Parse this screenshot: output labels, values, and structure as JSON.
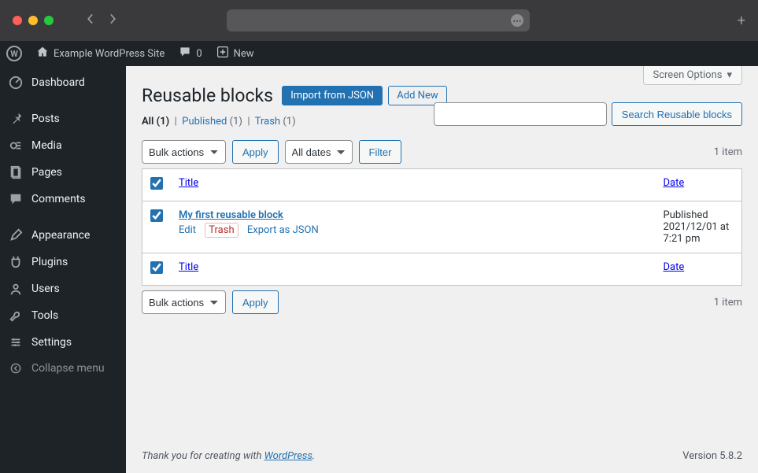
{
  "browser": {
    "plus": "+"
  },
  "adminbar": {
    "site_name": "Example WordPress Site",
    "comments_count": "0",
    "new_label": "New"
  },
  "sidebar": {
    "items": [
      {
        "icon": "dashboard",
        "label": "Dashboard"
      },
      {
        "icon": "pin",
        "label": "Posts"
      },
      {
        "icon": "media",
        "label": "Media"
      },
      {
        "icon": "page",
        "label": "Pages"
      },
      {
        "icon": "comment",
        "label": "Comments"
      },
      {
        "icon": "appearance",
        "label": "Appearance"
      },
      {
        "icon": "plugin",
        "label": "Plugins"
      },
      {
        "icon": "user",
        "label": "Users"
      },
      {
        "icon": "tool",
        "label": "Tools"
      },
      {
        "icon": "settings",
        "label": "Settings"
      }
    ],
    "collapse_label": "Collapse menu"
  },
  "screen_options": "Screen Options",
  "page_title": "Reusable blocks",
  "actions": {
    "import_json": "Import from JSON",
    "add_new": "Add New"
  },
  "filters": {
    "all_label": "All",
    "all_count": "(1)",
    "published_label": "Published",
    "published_count": "(1)",
    "trash_label": "Trash",
    "trash_count": "(1)"
  },
  "search": {
    "button": "Search Reusable blocks"
  },
  "bulk": {
    "select_label": "Bulk actions",
    "apply_label": "Apply",
    "dates_label": "All dates",
    "filter_label": "Filter"
  },
  "items_count": "1 item",
  "table": {
    "col_title": "Title",
    "col_date": "Date",
    "rows": [
      {
        "title": "My first reusable block",
        "actions": {
          "edit": "Edit",
          "trash": "Trash",
          "export": "Export as JSON"
        },
        "status": "Published",
        "date": "2021/12/01 at 7:21 pm"
      }
    ]
  },
  "footer": {
    "thank_you_prefix": "Thank you for creating with ",
    "wordpress": "WordPress",
    "period": ".",
    "version": "Version 5.8.2"
  }
}
